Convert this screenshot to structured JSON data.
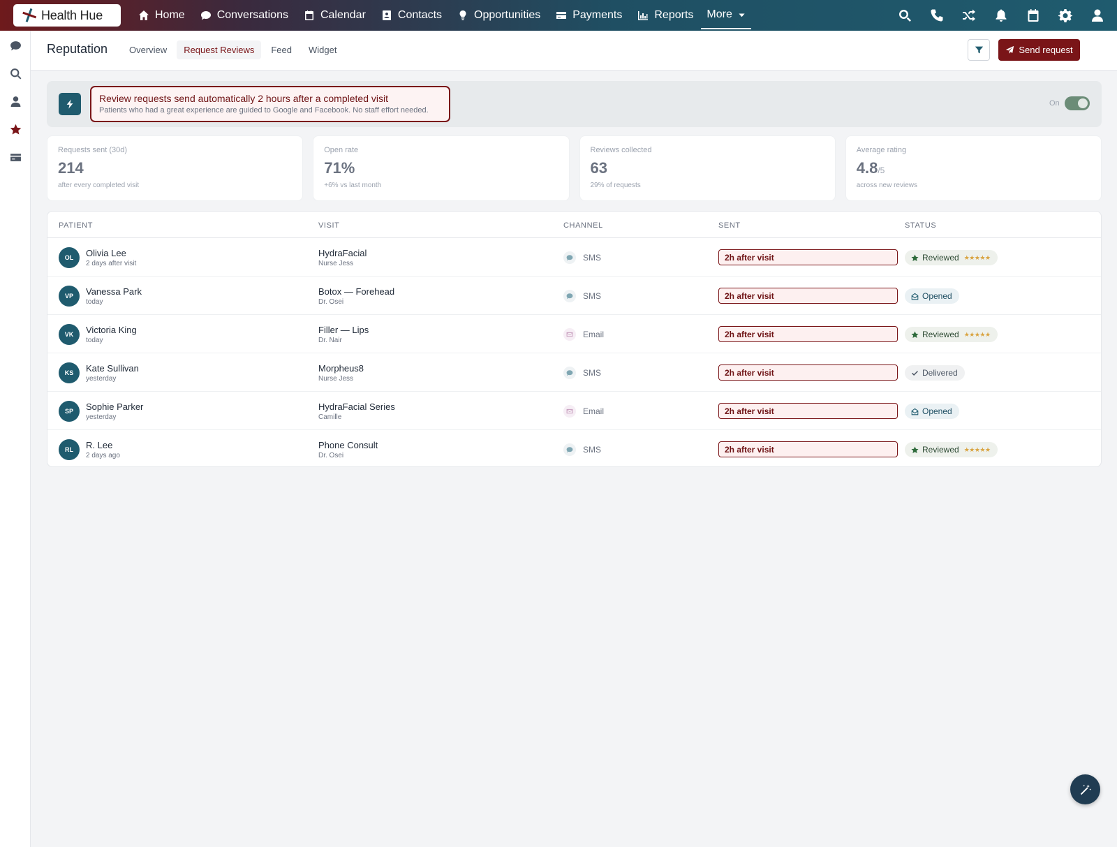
{
  "brand": {
    "name": "Health Hue"
  },
  "nav": {
    "items": [
      {
        "label": "Home",
        "icon": "home-icon"
      },
      {
        "label": "Conversations",
        "icon": "chat-icon"
      },
      {
        "label": "Calendar",
        "icon": "calendar-icon"
      },
      {
        "label": "Contacts",
        "icon": "contact-card-icon"
      },
      {
        "label": "Opportunities",
        "icon": "lightbulb-icon"
      },
      {
        "label": "Payments",
        "icon": "credit-card-icon"
      },
      {
        "label": "Reports",
        "icon": "bar-chart-icon"
      }
    ],
    "more_label": "More",
    "right_icons": [
      "search-icon",
      "phone-icon",
      "shuffle-icon",
      "bell-icon",
      "calendar-icon",
      "gear-icon",
      "user-icon"
    ]
  },
  "rail": {
    "icons": [
      "chat-icon",
      "search-icon",
      "user-icon",
      "star-icon",
      "card-icon"
    ],
    "active": "star-icon"
  },
  "header": {
    "title": "Reputation",
    "tabs": [
      {
        "label": "Overview"
      },
      {
        "label": "Request Reviews"
      },
      {
        "label": "Feed"
      },
      {
        "label": "Widget"
      }
    ],
    "active_tab": "Request Reviews",
    "send_button": "Send request"
  },
  "banner": {
    "title": "Review requests send automatically 2 hours after a completed visit",
    "subtitle": "Patients who had a great experience are guided to Google and Facebook. No staff effort needed.",
    "toggle_label": "On",
    "toggle_on": true
  },
  "stats": [
    {
      "label": "Requests sent (30d)",
      "value": "214",
      "suffix": "",
      "note": "after every completed visit"
    },
    {
      "label": "Open rate",
      "value": "71%",
      "suffix": "",
      "note": "+6% vs last month"
    },
    {
      "label": "Reviews collected",
      "value": "63",
      "suffix": "",
      "note": "29% of requests"
    },
    {
      "label": "Average rating",
      "value": "4.8",
      "suffix": "/5",
      "note": "across new reviews"
    }
  ],
  "table": {
    "columns": [
      "PATIENT",
      "VISIT",
      "CHANNEL",
      "SENT",
      "STATUS"
    ],
    "rows": [
      {
        "initials": "OL",
        "name": "Olivia Lee",
        "when": "2 days after visit",
        "visit": "HydraFacial",
        "provider": "Nurse Jess",
        "channel": "SMS",
        "sent": "2h after visit",
        "status": "Reviewed",
        "stars": "★★★★★"
      },
      {
        "initials": "VP",
        "name": "Vanessa Park",
        "when": "today",
        "visit": "Botox — Forehead",
        "provider": "Dr. Osei",
        "channel": "SMS",
        "sent": "2h after visit",
        "status": "Opened",
        "stars": ""
      },
      {
        "initials": "VK",
        "name": "Victoria King",
        "when": "today",
        "visit": "Filler — Lips",
        "provider": "Dr. Nair",
        "channel": "Email",
        "sent": "2h after visit",
        "status": "Reviewed",
        "stars": "★★★★★"
      },
      {
        "initials": "KS",
        "name": "Kate Sullivan",
        "when": "yesterday",
        "visit": "Morpheus8",
        "provider": "Nurse Jess",
        "channel": "SMS",
        "sent": "2h after visit",
        "status": "Delivered",
        "stars": ""
      },
      {
        "initials": "SP",
        "name": "Sophie Parker",
        "when": "yesterday",
        "visit": "HydraFacial Series",
        "provider": "Camille",
        "channel": "Email",
        "sent": "2h after visit",
        "status": "Opened",
        "stars": ""
      },
      {
        "initials": "RL",
        "name": "R. Lee",
        "when": "2 days ago",
        "visit": "Phone Consult",
        "provider": "Dr. Osei",
        "channel": "SMS",
        "sent": "2h after visit",
        "status": "Reviewed",
        "stars": "★★★★★"
      }
    ]
  },
  "colors": {
    "brand": "#7a1518",
    "teal": "#1f5b6e",
    "star": "#d9a441"
  }
}
